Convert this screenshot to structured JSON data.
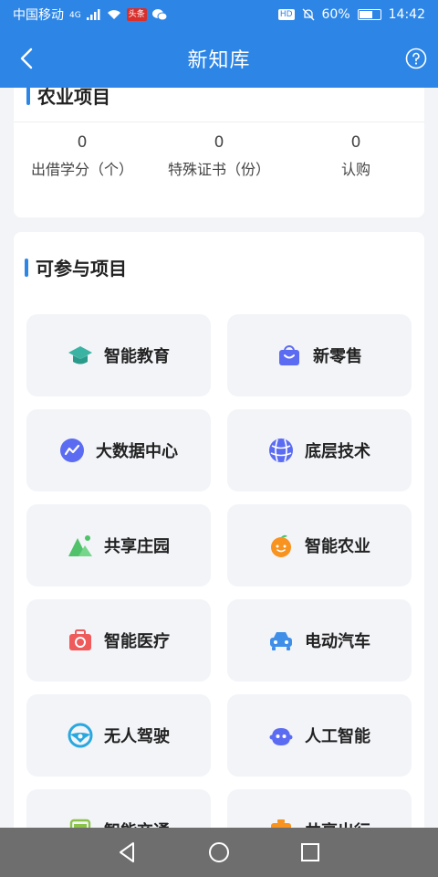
{
  "status_bar": {
    "carrier": "中国移动",
    "network": "4G",
    "news_badge": "头条",
    "hd_badge": "HD",
    "battery": "60%",
    "time": "14:42"
  },
  "nav": {
    "title": "新知库"
  },
  "top_section": {
    "title": "农业项目",
    "stats": [
      {
        "value": "0",
        "label": "出借学分（个）"
      },
      {
        "value": "0",
        "label": "特殊证书（份）"
      },
      {
        "value": "0",
        "label": "认购"
      }
    ]
  },
  "projects": {
    "title": "可参与项目",
    "items": [
      {
        "label": "智能教育",
        "icon": "graduation-cap-icon",
        "color": "#3bb3a3"
      },
      {
        "label": "新零售",
        "icon": "shopping-bag-icon",
        "color": "#5b6cf2"
      },
      {
        "label": "大数据中心",
        "icon": "trend-chart-icon",
        "color": "#5b6cf2"
      },
      {
        "label": "底层技术",
        "icon": "globe-icon",
        "color": "#5b6cf2"
      },
      {
        "label": "共享庄园",
        "icon": "mountain-icon",
        "color": "#4fc26a"
      },
      {
        "label": "智能农业",
        "icon": "orange-fruit-icon",
        "color": "#f7931e"
      },
      {
        "label": "智能医疗",
        "icon": "medical-kit-icon",
        "color": "#ef5a5a"
      },
      {
        "label": "电动汽车",
        "icon": "car-icon",
        "color": "#3f8fe8"
      },
      {
        "label": "无人驾驶",
        "icon": "steering-wheel-icon",
        "color": "#29a8e0"
      },
      {
        "label": "人工智能",
        "icon": "robot-face-icon",
        "color": "#5b6cf2"
      },
      {
        "label": "智能交通",
        "icon": "bus-icon",
        "color": "#8bc34a"
      },
      {
        "label": "共享出行",
        "icon": "taxi-icon",
        "color": "#f7931e"
      }
    ]
  }
}
